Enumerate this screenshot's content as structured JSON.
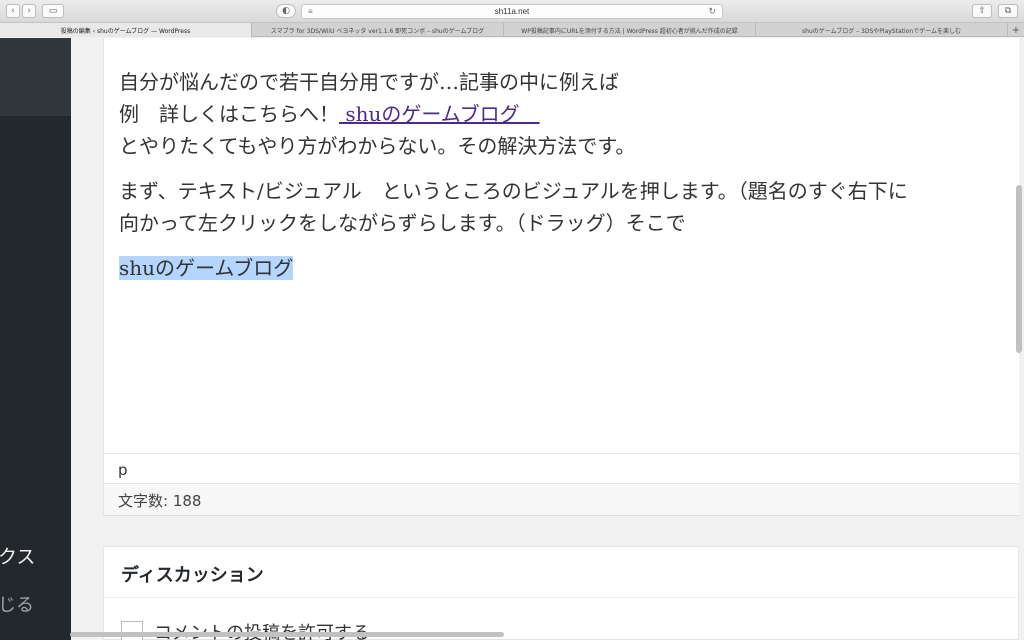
{
  "browser": {
    "url": "sh11a.net",
    "tabs": [
      {
        "label": "投稿の編集 ‹ shuのゲームブログ — WordPress",
        "active": true
      },
      {
        "label": "スマブラ for 3DS/WiiU ベヨネッタ ver1.1.6 即死コンボ – shuのゲームブログ",
        "active": false
      },
      {
        "label": "WP投稿記事内にURLを添付する方法 | WordPress 超初心者が挑んだ作成の記録",
        "active": false
      },
      {
        "label": "shuのゲームブログ – 3DSやPlayStationでゲームを楽しむ",
        "active": false
      }
    ],
    "new_tab": "+"
  },
  "sidebar": {
    "item_partial_1": "クス",
    "item_partial_2": "じる"
  },
  "editor": {
    "p1_line1": "自分が悩んだので若干自分用ですが…記事の中に例えば",
    "p1_line2_prefix": "例　詳しくはこちらへ！",
    "p1_link": " shuのゲームブログ　",
    "p1_line3": "とやりたくてもやり方がわからない。その解決方法です。",
    "p2_line1": "まず、テキスト/ビジュアル　というところのビジュアルを押します。（題名のすぐ右下に",
    "p2_line2": "向かって左クリックをしながらずらします。（ドラッグ）そこで",
    "p3_selected": "shuのゲームブログ"
  },
  "path_bar": "p",
  "word_count": "文字数: 188",
  "discussion": {
    "title": "ディスカッション",
    "checkbox_label": "コメントの投稿を許可する"
  }
}
